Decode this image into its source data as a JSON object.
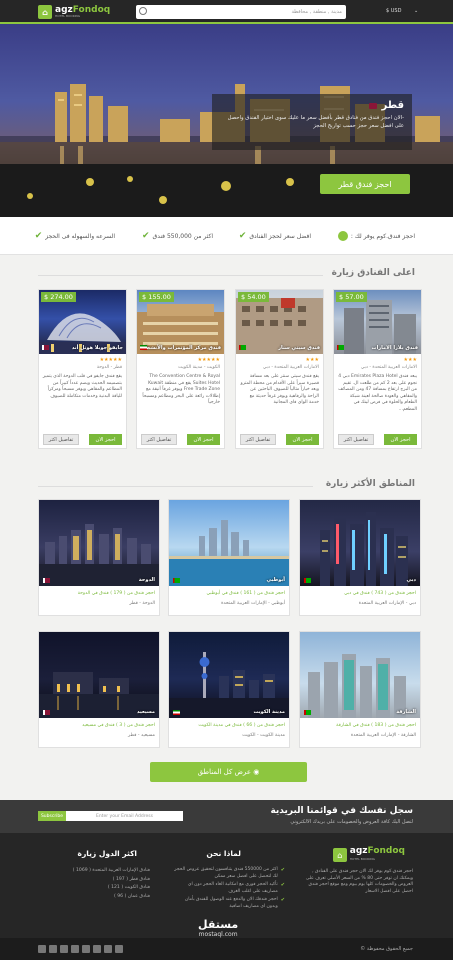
{
  "header": {
    "logo_main": "agz",
    "logo_accent": "Fondoq",
    "logo_sub": "HOTEL BOOKING",
    "search_placeholder": "مدينة , منطقة , محافظة",
    "currency": "$ USD",
    "language": "⌄"
  },
  "hero": {
    "country": "قطر",
    "description": "-الان احجز فندق من فنادق قطر بأفضل سعر ما عليك سوى اختيار الفندق واحصل على افضل سعر حجز حسب تواريخ الحجز",
    "button": "احجز فندق قطر",
    "slides": 2
  },
  "features": {
    "label": "احجز فندق.كوم يوفر لك :",
    "items": [
      "افضل سعر لحجز الفنادق",
      "اكثر من 550,000 فندق",
      "السرعه والسهوله فى الحجز"
    ]
  },
  "top_hotels": {
    "title": "اعلى الفنادق زيارة",
    "view_btn": "احجز الان",
    "details_btn": "تفاصيل اكثر",
    "cards": [
      {
        "price": "$ 57.00",
        "name": "فندق بلازا الامارات",
        "stars": 3,
        "location": "الامارات العربية المتحدة - دبي",
        "desc": "يبعد فندق Emirates Plaza Hotel دبي 4 نجوم على بعد 2 كم من طلعت ال. تقيم من البرج ارتفاع بمسافة 47 ومن المصائف والمقاهي والعودة صالحة لعينة شبكة الطعام والحلوة في فرص لينك في المطعم..."
      },
      {
        "price": "$ 54.00",
        "name": "فندق سيتي ستار",
        "stars": 3,
        "location": "الامارات العربية المتحدة - دبي",
        "desc": "يقع فندق سيتي سنتر على بعد مسافة قصيرة سيراً على الأقدام من محطة المترو ويعد خياراً مثالياً للضيوف الباحثين عن الراحة والرفاهية ويوفر غرفاً حديثة مع خدمة الواي فاي المجانية"
      },
      {
        "price": "$ 155.00",
        "name": "فندق مركز المؤتمرات والأنشطة",
        "stars": 5,
        "location": "الكويت - مدينة الكويت",
        "desc": "The Convention Centre & Royal Suites Hotel يقع في منطقة Kuwait Free Trade Zone ويوفر غرفاً أنيقة مع إطلالات رائعة على البحر ومطاعم ومسبحاً خارجياً"
      },
      {
        "price": "$ 274.00",
        "name": "جايفو جوبلا هوتل أند",
        "stars": 5,
        "location": "قطر - الدوحة",
        "desc": "يقع فندق جايفو في قلب الدوحة الذي يتميز بتصميمه الحديث ويضم عدداً كبيراً من المطاعم والمقاهي ويوفر مسبحاً ومركزاً للياقة البدنية وخدمات متكاملة للضيوف"
      }
    ]
  },
  "regions": {
    "title": "المناطق الأكثر زيارة",
    "all_btn": "◉ عرض كل المناطق",
    "items": [
      {
        "name": "دبي",
        "hotels_line": "احجز فندق من ( 743 ) فندق في دبي",
        "location": "دبي - الإمارات العربية المتحدة"
      },
      {
        "name": "أبوظبي",
        "hotels_line": "احجز فندق من ( 161 ) فندق في أبوظبي",
        "location": "أبوظبي - الإمارات العربية المتحدة"
      },
      {
        "name": "الدوحة",
        "hotels_line": "احجز فندق من ( 179 ) فندق في الدوحة",
        "location": "الدوحة - قطر"
      },
      {
        "name": "الشارقة",
        "hotels_line": "احجز فندق من ( 183 ) فندق في الشارقة",
        "location": "الشارقة - الإمارات العربية المتحدة"
      },
      {
        "name": "مدينة الكويت",
        "hotels_line": "احجز فندق من ( 66 ) فندق في مدينة الكويت",
        "location": "مدينة الكويت - الكويت"
      },
      {
        "name": "مسيعيد",
        "hotels_line": "احجز فندق من ( 3 ) فندق في مسيعيد",
        "location": "مسيعيد - قطر"
      }
    ]
  },
  "newsletter": {
    "heading": "سجل نفسك في قوائمنا البريدية",
    "sub": "لتصل اليك كافة العروض والخصومات على بريدك الالكتروني",
    "placeholder": "Enter your Email Address",
    "button": "Subscribe"
  },
  "footer": {
    "about": "احجز فندق.كوم يوفر لك الان حجز فندق على الفنادق , ويمكنك ان توفر حتى 80 % من السعر الأصلي تعرف على العروض والخصومات كلها يوم بيوم ومع موقع احجز فندق احصل على افضل الاسعار",
    "why_title": "لماذا نحن",
    "why": [
      "اكثر من 550000 فندق يتنافسون لتحقيق عروض الحجز لك لتحصل على افضل سعر ممكن",
      "تأكيد الحجز فوري مع امكانية الغاء الحجز دون اي مصاريف على اغلب الغرف",
      "احجز فندقك الان والدفع عند الوصول للفندق بأمان وبدون اي مصاريف اضافية"
    ],
    "countries_title": "اكثر الدول زيارة",
    "countries": [
      "فنادق الإمارات العربية المتحدة ( 1069 )",
      "فنادق قطر ( 197 )",
      "فنادق الكويت ( 121 )",
      "فنادق عمان ( 96 )"
    ],
    "copyright": "جميع الحقوق محفوظة ©",
    "watermark": "مستقل",
    "watermark_sub": "mostaql.com"
  }
}
